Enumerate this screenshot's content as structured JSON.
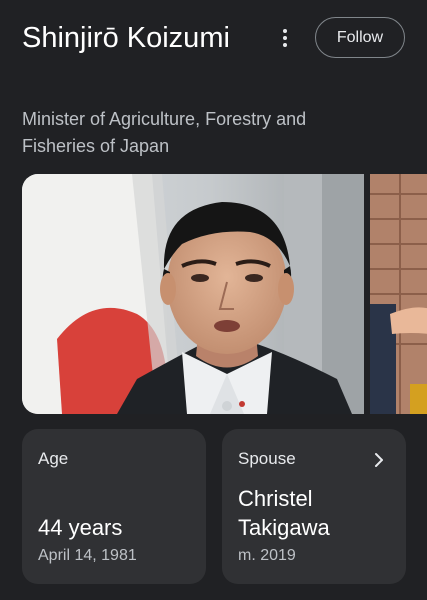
{
  "header": {
    "name": "Shinjirō Koizumi",
    "follow_label": "Follow",
    "more_icon": "more-vert-icon"
  },
  "subtitle": "Minister of Agriculture, Forestry and Fisheries of Japan",
  "cards": {
    "age": {
      "label": "Age",
      "value": "44 years",
      "sub": "April 14, 1981"
    },
    "spouse": {
      "label": "Spouse",
      "value": "Christel Takigawa",
      "sub": "m. 2019",
      "icon": "chevron-right-icon"
    }
  }
}
